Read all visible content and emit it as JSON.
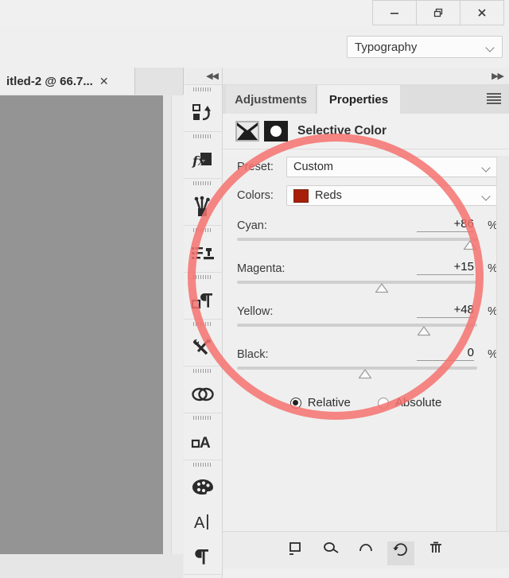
{
  "window": {
    "minimize_label": "—",
    "restore_label": "❐",
    "close_label": "✕"
  },
  "options_bar": {
    "workspace": "Typography",
    "workspace_chevron": "chevron-down-icon"
  },
  "document": {
    "tab_title": "itled-2 @ 66.7...",
    "tab_close": "✕"
  },
  "rail": {
    "collapse_arrows": "◀◀",
    "items": [
      {
        "name": "actions-icon"
      },
      {
        "name": "styles-fx-icon"
      },
      {
        "name": "brush-presets-icon"
      },
      {
        "name": "clone-source-icon"
      },
      {
        "name": "paragraph-styles-icon"
      },
      {
        "name": "tool-presets-icon"
      },
      {
        "name": "cc-libraries-icon"
      },
      {
        "name": "character-styles-icon"
      },
      {
        "name": "swatches-icon"
      },
      {
        "name": "character-icon"
      },
      {
        "name": "paragraph-icon"
      }
    ]
  },
  "panel": {
    "expand_arrows": "▶▶",
    "tabs": [
      {
        "label": "Adjustments",
        "active": false
      },
      {
        "label": "Properties",
        "active": true
      }
    ],
    "menu_icon": "panel-menu-icon",
    "title": "Selective Color",
    "layer_thumbnail_icon": "layer-thumbnail-icon",
    "mask_thumbnail_icon": "mask-thumbnail-icon",
    "preset": {
      "label": "Preset:",
      "value": "Custom",
      "chevron": "chevron-down-icon"
    },
    "colors": {
      "label": "Colors:",
      "value": "Reds",
      "swatch_color": "#a81e08",
      "chevron": "chevron-down-icon"
    },
    "sliders": [
      {
        "label": "Cyan:",
        "value": "+86",
        "unit": "%",
        "pos": 93
      },
      {
        "label": "Magenta:",
        "value": "+15",
        "unit": "%",
        "pos": 57
      },
      {
        "label": "Yellow:",
        "value": "+48",
        "unit": "%",
        "pos": 74
      },
      {
        "label": "Black:",
        "value": "0",
        "unit": "%",
        "pos": 50
      }
    ],
    "method": {
      "relative_label": "Relative",
      "absolute_label": "Absolute",
      "selected": "Relative"
    },
    "footer_icons": [
      {
        "name": "clip-to-layer-icon",
        "selected": false
      },
      {
        "name": "view-previous-state-icon",
        "selected": false
      },
      {
        "name": "toggle-visibility-icon",
        "selected": false
      },
      {
        "name": "reset-icon",
        "selected": true
      },
      {
        "name": "delete-icon",
        "selected": false
      }
    ]
  },
  "annotation": {
    "shape": "ellipse-highlight",
    "color": "#f4726e"
  }
}
